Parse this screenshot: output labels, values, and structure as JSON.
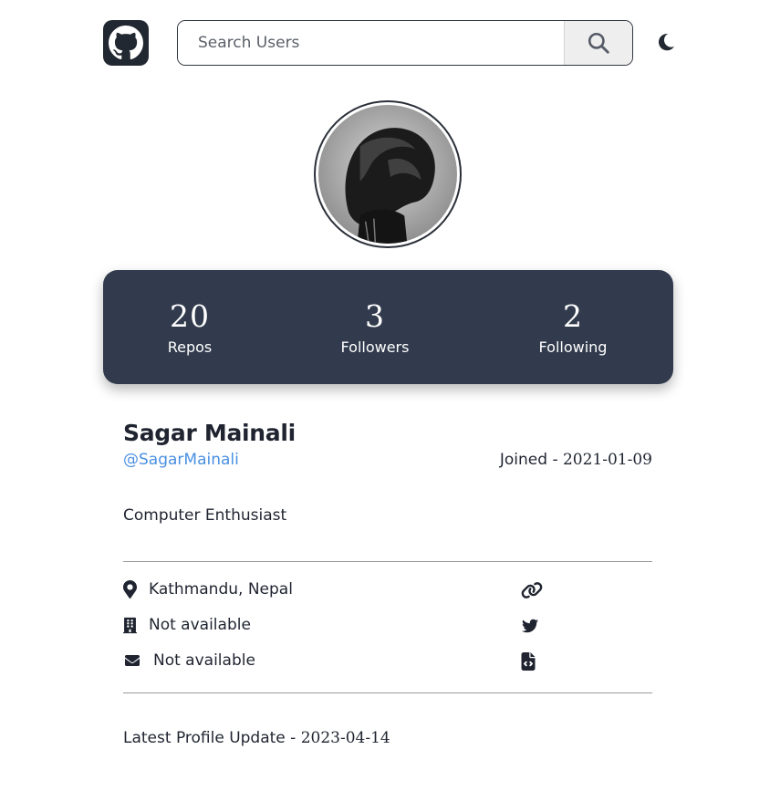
{
  "header": {
    "logo_icon": "github-icon",
    "search_placeholder": "Search Users",
    "search_icon": "search-icon",
    "theme_icon": "moon-icon"
  },
  "profile": {
    "avatar_icon": "user-avatar",
    "name": "Sagar Mainali",
    "handle": "@SagarMainali",
    "joined_label": "Joined - ",
    "joined_date": "2021-01-09",
    "bio": "Computer Enthusiast"
  },
  "stats": [
    {
      "value": "20",
      "label": "Repos"
    },
    {
      "value": "3",
      "label": "Followers"
    },
    {
      "value": "2",
      "label": "Following"
    }
  ],
  "info": {
    "location": "Kathmandu, Nepal",
    "company": "Not available",
    "email": "Not available",
    "location_icon": "map-pin-icon",
    "company_icon": "building-icon",
    "email_icon": "envelope-icon",
    "website_icon": "link-icon",
    "twitter_icon": "twitter-icon",
    "gist_icon": "file-code-icon"
  },
  "footer": {
    "updated_label": "Latest Profile Update - ",
    "updated_date": "2023-04-14"
  },
  "colors": {
    "stats_bg": "#323b4d",
    "accent_link": "#4a90e2",
    "logo_bg": "#222831",
    "text": "#1f2430"
  }
}
